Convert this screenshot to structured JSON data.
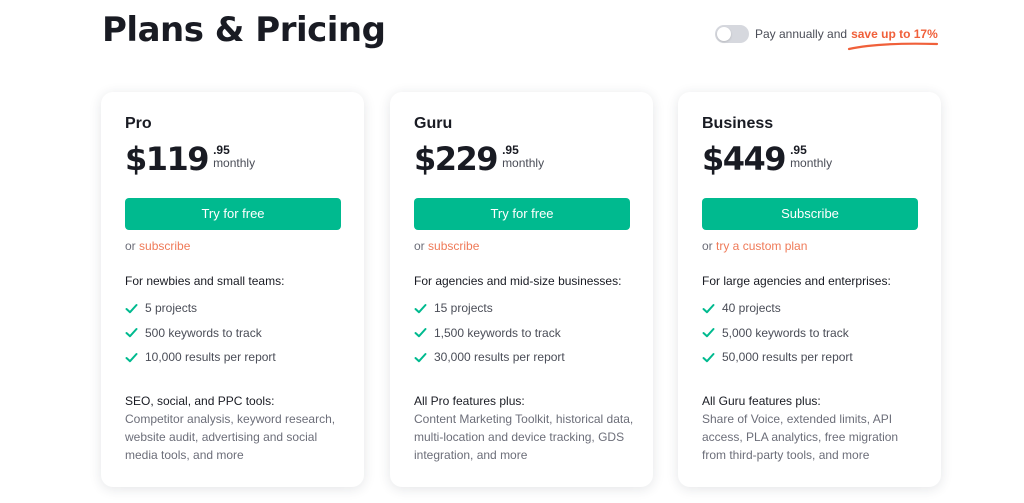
{
  "header": {
    "title": "Plans & Pricing",
    "billing_toggle": {
      "state": "off",
      "label": "Pay annually and",
      "highlight": "save up to 17%"
    }
  },
  "colors": {
    "accent_green": "#00ba8f",
    "accent_orange": "#f0603a",
    "link_orange": "#ef7a58",
    "text_dark": "#191b23"
  },
  "plans": [
    {
      "name": "Pro",
      "price": "$119",
      "cents": ".95",
      "period": "monthly",
      "cta": "Try for free",
      "alt_prefix": "or",
      "alt_link": "subscribe",
      "audience": "For newbies and small teams:",
      "features": [
        "5 projects",
        "500 keywords to track",
        "10,000 results per report"
      ],
      "extras_title": "SEO, social, and PPC tools:",
      "extras_desc": "Competitor analysis, keyword research, website audit, advertising and social media tools, and more"
    },
    {
      "name": "Guru",
      "price": "$229",
      "cents": ".95",
      "period": "monthly",
      "cta": "Try for free",
      "alt_prefix": "or",
      "alt_link": "subscribe",
      "audience": "For agencies and mid-size businesses:",
      "features": [
        "15 projects",
        "1,500 keywords to track",
        "30,000 results per report"
      ],
      "extras_title": "All Pro features plus:",
      "extras_desc": "Content Marketing Toolkit, historical data, multi-location and device tracking, GDS integration, and more"
    },
    {
      "name": "Business",
      "price": "$449",
      "cents": ".95",
      "period": "monthly",
      "cta": "Subscribe",
      "alt_prefix": "or",
      "alt_link": "try a custom plan",
      "audience": "For large agencies and enterprises:",
      "features": [
        "40 projects",
        "5,000 keywords to track",
        "50,000 results per report"
      ],
      "extras_title": "All Guru features plus:",
      "extras_desc": "Share of Voice, extended limits, API access, PLA analytics, free migration from third-party tools, and more"
    }
  ]
}
